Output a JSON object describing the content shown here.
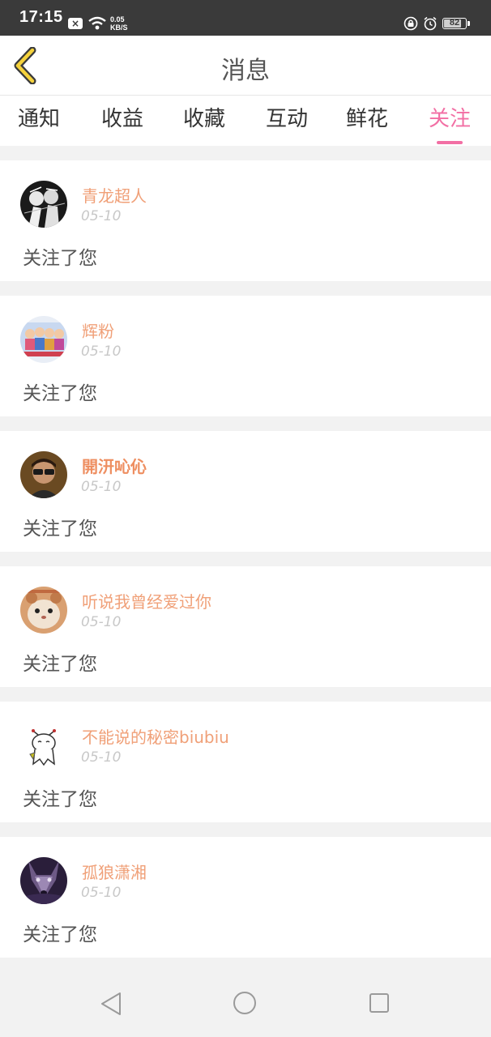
{
  "status_bar": {
    "time": "17:15",
    "speed_value": "0.05",
    "speed_unit": "KB/S",
    "battery_level": "82",
    "battery_fraction": 0.82,
    "icons": [
      "close-notification-icon",
      "wifi-icon",
      "lock-icon",
      "alarm-icon",
      "battery-icon"
    ],
    "background": "#3a3a3a"
  },
  "header": {
    "title": "消息",
    "back_icon": "chevron-left-icon",
    "back_icon_color": "#f5d23c"
  },
  "tabs": [
    {
      "label": "通知",
      "active": false
    },
    {
      "label": "收益",
      "active": false
    },
    {
      "label": "收藏",
      "active": false
    },
    {
      "label": "互动",
      "active": false
    },
    {
      "label": "鲜花",
      "active": false
    },
    {
      "label": "关注",
      "active": true
    }
  ],
  "accent_color": "#f26fa4",
  "name_color": "#f0a078",
  "notifications": [
    {
      "name": "青龙超人",
      "date": "05-10",
      "action": "关注了您",
      "avatar": "anime-sketch-avatar"
    },
    {
      "name": "辉粉",
      "date": "05-10",
      "action": "关注了您",
      "avatar": "group-photo-avatar"
    },
    {
      "name": "開汧吣伈",
      "date": "05-10",
      "action": "关注了您",
      "avatar": "man-sunglasses-avatar"
    },
    {
      "name": "听说我曾经爱过你",
      "date": "05-10",
      "action": "关注了您",
      "avatar": "hamster-avatar"
    },
    {
      "name": "不能说的秘密biubiu",
      "date": "05-10",
      "action": "关注了您",
      "avatar": "cartoon-ghost-avatar"
    },
    {
      "name": "孤狼潇湘",
      "date": "05-10",
      "action": "关注了您",
      "avatar": "wolf-avatar"
    }
  ],
  "nav_bar": {
    "icons": [
      "nav-back-icon",
      "nav-home-icon",
      "nav-recent-apps-icon"
    ]
  }
}
